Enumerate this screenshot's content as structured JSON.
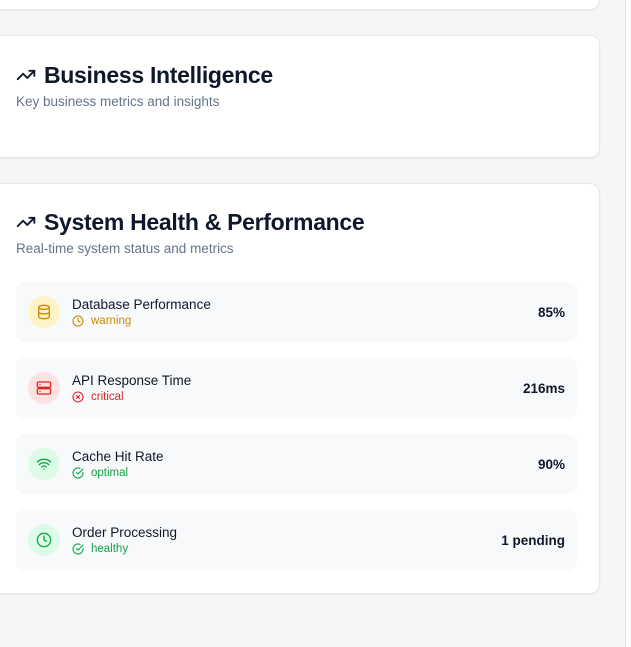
{
  "business_intelligence": {
    "title": "Business Intelligence",
    "subtitle": "Key business metrics and insights",
    "icon": "trending-up-icon"
  },
  "system_health": {
    "title": "System Health & Performance",
    "subtitle": "Real-time system status and metrics",
    "icon": "trending-up-icon",
    "metrics": [
      {
        "name": "Database Performance",
        "status": "warning",
        "value": "85%",
        "icon": "database-icon",
        "status_icon": "clock-icon",
        "icon_bg": "#fef3c7",
        "icon_color": "#ca8a04",
        "status_color": "#ca8a04"
      },
      {
        "name": "API Response Time",
        "status": "critical",
        "value": "216ms",
        "icon": "server-icon",
        "status_icon": "x-circle-icon",
        "icon_bg": "#fee2e2",
        "icon_color": "#dc2626",
        "status_color": "#dc2626"
      },
      {
        "name": "Cache Hit Rate",
        "status": "optimal",
        "value": "90%",
        "icon": "wifi-icon",
        "status_icon": "check-circle-icon",
        "icon_bg": "#dcfce7",
        "icon_color": "#16a34a",
        "status_color": "#16a34a"
      },
      {
        "name": "Order Processing",
        "status": "healthy",
        "value": "1 pending",
        "icon": "clock-icon",
        "status_icon": "check-circle-icon",
        "icon_bg": "#dcfce7",
        "icon_color": "#16a34a",
        "status_color": "#16a34a"
      }
    ]
  }
}
